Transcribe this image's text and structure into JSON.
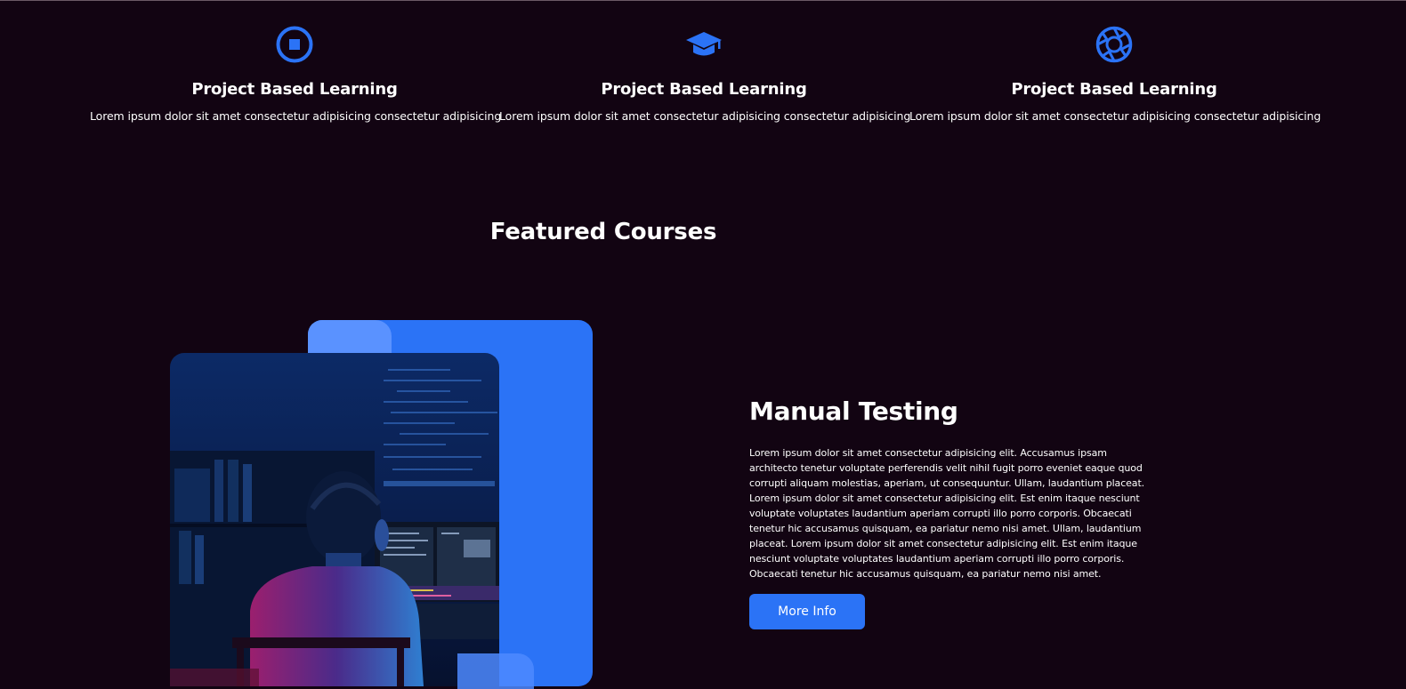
{
  "features": [
    {
      "icon": "stop-circle-icon",
      "title": "Project Based Learning",
      "text": "Lorem ipsum dolor sit amet consectetur adipisicing consectetur adipisicing"
    },
    {
      "icon": "graduation-cap-icon",
      "title": "Project Based Learning",
      "text": "Lorem ipsum dolor sit amet consectetur adipisicing consectetur adipisicing"
    },
    {
      "icon": "aperture-icon",
      "title": "Project Based Learning",
      "text": "Lorem ipsum dolor sit amet consectetur adipisicing consectetur adipisicing"
    }
  ],
  "section_title": "Featured Courses",
  "course": {
    "title": "Manual Testing",
    "description": "Lorem ipsum dolor sit amet consectetur adipisicing elit. Accusamus ipsam architecto tenetur voluptate perferendis velit nihil fugit porro eveniet eaque quod corrupti aliquam molestias, aperiam, ut consequuntur. Ullam, laudantium placeat. Lorem ipsum dolor sit amet consectetur adipisicing elit. Est enim itaque nesciunt voluptate voluptates laudantium aperiam corrupti illo porro corporis. Obcaecati tenetur hic accusamus quisquam, ea pariatur nemo nisi amet. Ullam, laudantium placeat. Lorem ipsum dolor sit amet consectetur adipisicing elit. Est enim itaque nesciunt voluptate voluptates laudantium aperiam corrupti illo porro corporis. Obcaecati tenetur hic accusamus quisquam, ea pariatur nemo nisi amet.",
    "button_label": "More Info",
    "image_icon": "programmer-photo"
  },
  "colors": {
    "background": "#120412",
    "accent": "#2b73f6",
    "accent_light": "#5a92ff",
    "text": "#ffffff"
  }
}
